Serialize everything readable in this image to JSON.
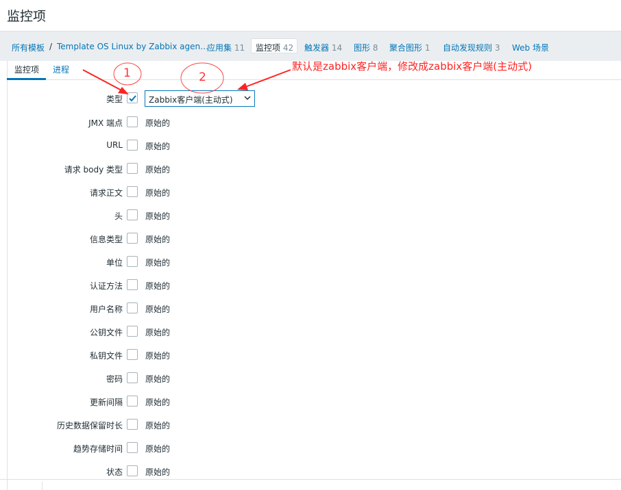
{
  "page": {
    "title": "监控项"
  },
  "breadcrumb": {
    "items": [
      {
        "label": "所有模板"
      },
      {
        "label": "Template OS Linux by Zabbix agen…"
      },
      {
        "label": "应用集",
        "count": "11"
      },
      {
        "label": "监控项",
        "count": "42",
        "active": true
      },
      {
        "label": "触发器",
        "count": "14"
      },
      {
        "label": "图形",
        "count": "8"
      },
      {
        "label": "聚合图形",
        "count": "1"
      },
      {
        "label": "自动发现规则",
        "count": "3"
      },
      {
        "label": "Web 场景"
      }
    ],
    "separator": "/"
  },
  "tabs": [
    {
      "label": "监控项",
      "active": true
    },
    {
      "label": "进程",
      "active": false
    }
  ],
  "form": {
    "type_row": {
      "label": "类型",
      "checked": true,
      "select_value": "Zabbix客户端(主动式)"
    },
    "rows": [
      {
        "label": "JMX 端点",
        "value": "原始的"
      },
      {
        "label": "URL",
        "value": "原始的"
      },
      {
        "label": "请求 body 类型",
        "value": "原始的"
      },
      {
        "label": "请求正文",
        "value": "原始的"
      },
      {
        "label": "头",
        "value": "原始的"
      },
      {
        "label": "信息类型",
        "value": "原始的"
      },
      {
        "label": "单位",
        "value": "原始的"
      },
      {
        "label": "认证方法",
        "value": "原始的"
      },
      {
        "label": "用户名称",
        "value": "原始的"
      },
      {
        "label": "公钥文件",
        "value": "原始的"
      },
      {
        "label": "私钥文件",
        "value": "原始的"
      },
      {
        "label": "密码",
        "value": "原始的"
      },
      {
        "label": "更新间隔",
        "value": "原始的"
      },
      {
        "label": "历史数据保留时长",
        "value": "原始的"
      },
      {
        "label": "趋势存储时间",
        "value": "原始的"
      },
      {
        "label": "状态",
        "value": "原始的"
      }
    ]
  },
  "annotations": {
    "note": "默认是zabbix客户端，修改成zabbix客户端(主动式)",
    "marker_1": "1",
    "marker_2": "2",
    "color": "#ff2222"
  },
  "colors": {
    "link": "#0275b8",
    "header_bg": "#ebeef0",
    "border": "#dde1e4",
    "text": "#1f2c33"
  },
  "icons": {
    "checkbox_check": "check-icon",
    "select_arrow": "chevron-down-icon"
  }
}
